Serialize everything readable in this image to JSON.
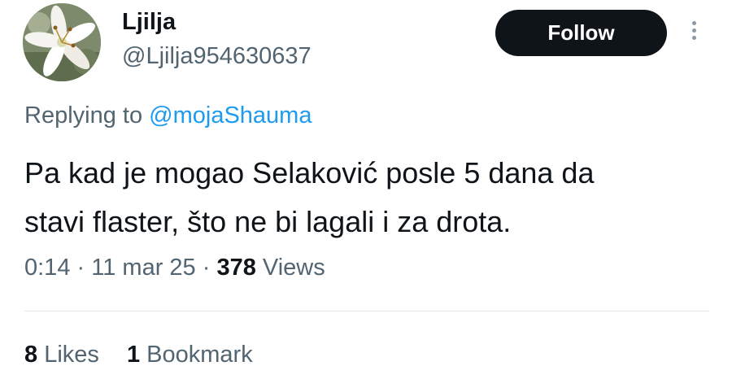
{
  "user": {
    "display_name": "Ljilja",
    "handle": "@Ljilja954630637"
  },
  "follow_label": "Follow",
  "reply": {
    "prefix": "Replying to",
    "mention": "@mojaShauma"
  },
  "tweet": {
    "line1": "Pa kad je mogao Selaković posle 5 dana da",
    "line2": "stavi flaster, što ne bi lagali i za drota."
  },
  "meta": {
    "time": "0:14",
    "date": "11 mar 25",
    "views_count": "378",
    "views_label": "Views"
  },
  "stats": {
    "likes_count": "8",
    "likes_label": "Likes",
    "bookmarks_count": "1",
    "bookmarks_label": "Bookmark"
  },
  "colors": {
    "link": "#1d9bf0",
    "secondary_text": "#536471",
    "primary_text": "#0f1419",
    "button_bg": "#0f1419"
  },
  "icons": {
    "more": "more-vertical-icon"
  }
}
